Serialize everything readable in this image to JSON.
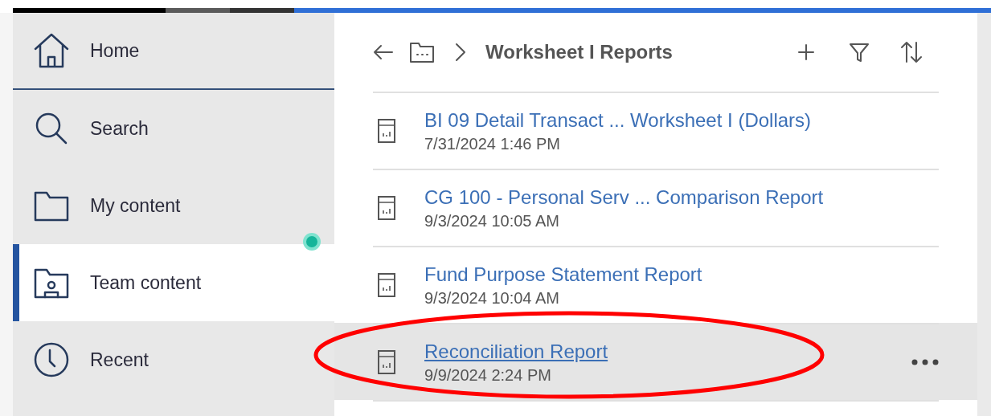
{
  "sidebar": {
    "items": [
      {
        "label": "Home",
        "kind": "home",
        "selected": false,
        "badge": false
      },
      {
        "label": "Search",
        "kind": "search",
        "selected": false,
        "badge": false
      },
      {
        "label": "My content",
        "kind": "folder",
        "selected": false,
        "badge": false
      },
      {
        "label": "Team content",
        "kind": "team",
        "selected": true,
        "badge": true
      },
      {
        "label": "Recent",
        "kind": "recent",
        "selected": false,
        "badge": false
      }
    ]
  },
  "header": {
    "title": "Worksheet I Reports"
  },
  "reports": [
    {
      "name": "BI 09 Detail Transact ... Worksheet I (Dollars)",
      "modified": "7/31/2024 1:46 PM",
      "hovered": false
    },
    {
      "name": "CG 100 - Personal Serv ... Comparison Report",
      "modified": "9/3/2024 10:05 AM",
      "hovered": false
    },
    {
      "name": "Fund Purpose Statement Report",
      "modified": "9/3/2024 10:04 AM",
      "hovered": false
    },
    {
      "name": "Reconciliation Report",
      "modified": "9/9/2024 2:24 PM",
      "hovered": true
    }
  ],
  "annotation": {
    "kind": "ellipse",
    "color": "#ff0000"
  }
}
